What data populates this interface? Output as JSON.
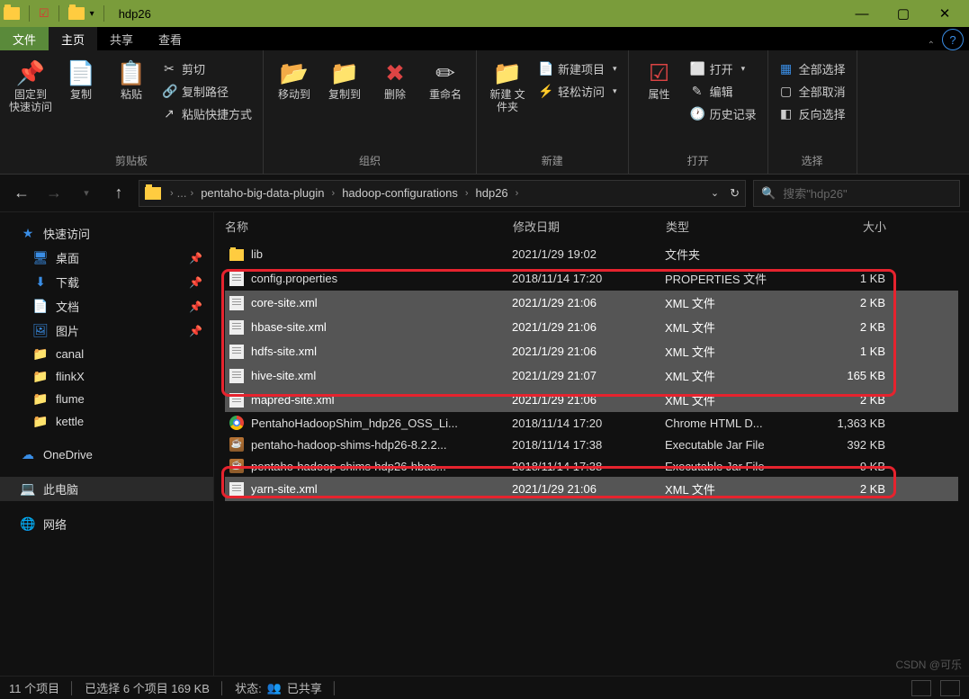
{
  "title": "hdp26",
  "tabs": {
    "file": "文件",
    "home": "主页",
    "share": "共享",
    "view": "查看"
  },
  "ribbon": {
    "clipboard": {
      "label": "剪贴板",
      "pin": "固定到\n快速访问",
      "copy": "复制",
      "paste": "粘贴",
      "cut": "剪切",
      "copypath": "复制路径",
      "pasteshortcut": "粘贴快捷方式"
    },
    "organize": {
      "label": "组织",
      "moveto": "移动到",
      "copyto": "复制到",
      "delete": "删除",
      "rename": "重命名"
    },
    "new_": {
      "label": "新建",
      "newfolder": "新建\n文件夹",
      "newitem": "新建项目",
      "easyaccess": "轻松访问"
    },
    "open": {
      "label": "打开",
      "properties": "属性",
      "open": "打开",
      "edit": "编辑",
      "history": "历史记录"
    },
    "select": {
      "label": "选择",
      "all": "全部选择",
      "none": "全部取消",
      "invert": "反向选择"
    }
  },
  "breadcrumb": [
    "pentaho-big-data-plugin",
    "hadoop-configurations",
    "hdp26"
  ],
  "search_placeholder": "搜索\"hdp26\"",
  "columns": {
    "name": "名称",
    "date": "修改日期",
    "type": "类型",
    "size": "大小"
  },
  "nav": {
    "quick": "快速访问",
    "desktop": "桌面",
    "downloads": "下载",
    "documents": "文档",
    "pictures": "图片",
    "f1": "canal",
    "f2": "flinkX",
    "f3": "flume",
    "f4": "kettle",
    "onedrive": "OneDrive",
    "thispc": "此电脑",
    "network": "网络"
  },
  "files": [
    {
      "icon": "folder",
      "name": "lib",
      "date": "2021/1/29 19:02",
      "type": "文件夹",
      "size": "",
      "sel": false
    },
    {
      "icon": "file",
      "name": "config.properties",
      "date": "2018/11/14 17:20",
      "type": "PROPERTIES 文件",
      "size": "1 KB",
      "sel": false
    },
    {
      "icon": "file",
      "name": "core-site.xml",
      "date": "2021/1/29 21:06",
      "type": "XML 文件",
      "size": "2 KB",
      "sel": true
    },
    {
      "icon": "file",
      "name": "hbase-site.xml",
      "date": "2021/1/29 21:06",
      "type": "XML 文件",
      "size": "2 KB",
      "sel": true
    },
    {
      "icon": "file",
      "name": "hdfs-site.xml",
      "date": "2021/1/29 21:06",
      "type": "XML 文件",
      "size": "1 KB",
      "sel": true
    },
    {
      "icon": "file",
      "name": "hive-site.xml",
      "date": "2021/1/29 21:07",
      "type": "XML 文件",
      "size": "165 KB",
      "sel": true
    },
    {
      "icon": "file",
      "name": "mapred-site.xml",
      "date": "2021/1/29 21:06",
      "type": "XML 文件",
      "size": "2 KB",
      "sel": true
    },
    {
      "icon": "chrome",
      "name": "PentahoHadoopShim_hdp26_OSS_Li...",
      "date": "2018/11/14 17:20",
      "type": "Chrome HTML D...",
      "size": "1,363 KB",
      "sel": false
    },
    {
      "icon": "jar",
      "name": "pentaho-hadoop-shims-hdp26-8.2.2...",
      "date": "2018/11/14 17:38",
      "type": "Executable Jar File",
      "size": "392 KB",
      "sel": false
    },
    {
      "icon": "jar",
      "name": "pentaho-hadoop-shims-hdp26-hbas...",
      "date": "2018/11/14 17:38",
      "type": "Executable Jar File",
      "size": "9 KB",
      "sel": false
    },
    {
      "icon": "file",
      "name": "yarn-site.xml",
      "date": "2021/1/29 21:06",
      "type": "XML 文件",
      "size": "2 KB",
      "sel": true
    }
  ],
  "status": {
    "count": "11 个项目",
    "selected": "已选择 6 个项目  169 KB",
    "state": "状态:",
    "shared": "已共享"
  },
  "watermark": "CSDN @可乐"
}
